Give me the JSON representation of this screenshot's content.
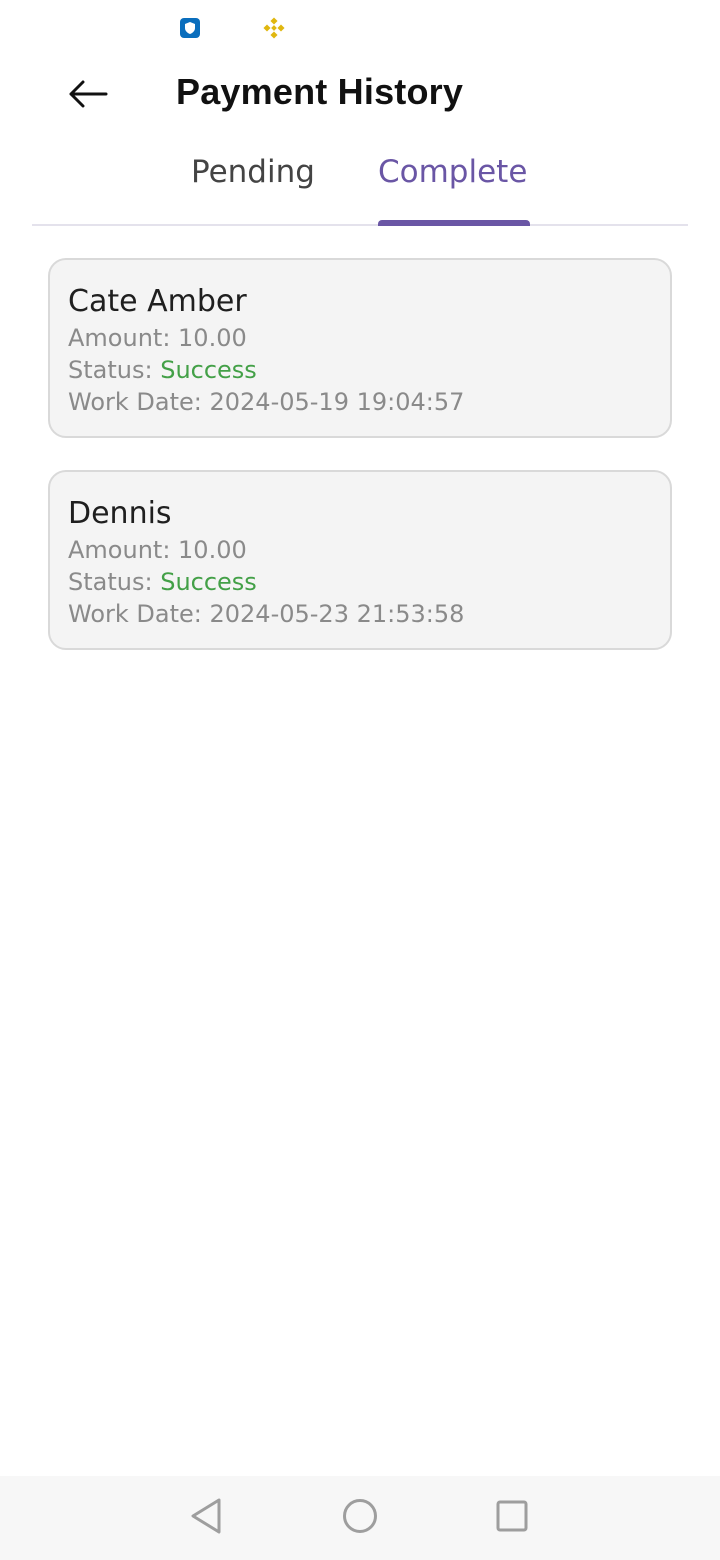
{
  "status_bar": {
    "icons": [
      "shield-app-icon",
      "binance-app-icon"
    ],
    "shield_color": "#0a6ebd",
    "binance_color": "#e0b70f"
  },
  "header": {
    "title": "Payment History",
    "back_icon": "arrow-left-icon"
  },
  "tabs": {
    "items": [
      {
        "label": "Pending",
        "active": false
      },
      {
        "label": "Complete",
        "active": true
      }
    ],
    "accent_color": "#6a56a5"
  },
  "payments": [
    {
      "name": "Cate Amber",
      "amount_label": "Amount: ",
      "amount": "10.00",
      "status_label": "Status: ",
      "status": "Success",
      "date_label": "Work Date: ",
      "date": "2024-05-19 19:04:57"
    },
    {
      "name": "Dennis",
      "amount_label": "Amount: ",
      "amount": "10.00",
      "status_label": "Status: ",
      "status": "Success",
      "date_label": "Work Date: ",
      "date": "2024-05-23 21:53:58"
    }
  ],
  "colors": {
    "success": "#43a047",
    "card_background": "#f4f4f4",
    "card_border": "#d9d9d9"
  },
  "nav_bar": {
    "icons": [
      "nav-back-icon",
      "nav-home-icon",
      "nav-recents-icon"
    ]
  }
}
